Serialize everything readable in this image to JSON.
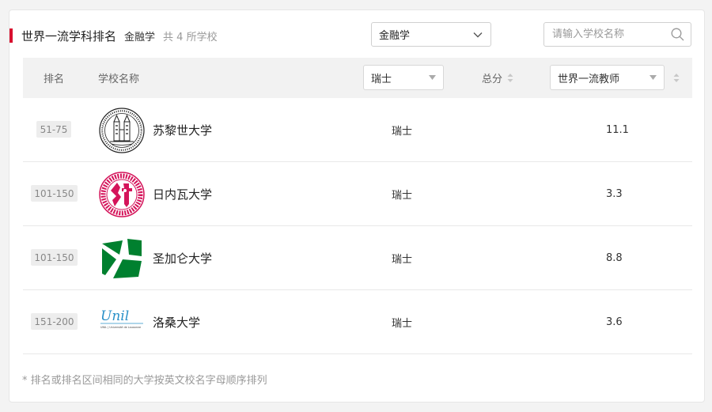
{
  "header": {
    "title": "世界一流学科排名",
    "subject": "金融学",
    "count_text": "共 4 所学校"
  },
  "subject_select": {
    "value": "金融学"
  },
  "search": {
    "placeholder": "请输入学校名称",
    "value": ""
  },
  "table": {
    "col_rank": "排名",
    "col_school": "学校名称",
    "col_country_filter": "瑞士",
    "col_total": "总分",
    "col_indicator": "世界一流教师"
  },
  "rows": [
    {
      "rank": "51-75",
      "school": "苏黎世大学",
      "country": "瑞士",
      "score": "11.1",
      "logo": "university-of-zurich-seal-icon"
    },
    {
      "rank": "101-150",
      "school": "日内瓦大学",
      "country": "瑞士",
      "score": "3.3",
      "logo": "university-of-geneva-seal-icon"
    },
    {
      "rank": "101-150",
      "school": "圣加仑大学",
      "country": "瑞士",
      "score": "8.8",
      "logo": "university-of-st-gallen-logo-icon"
    },
    {
      "rank": "151-200",
      "school": "洛桑大学",
      "country": "瑞士",
      "score": "3.6",
      "logo": "university-of-lausanne-logo-icon"
    }
  ],
  "unil_logo": {
    "wordmark": "Unil",
    "caption": "UNIL | Université de Lausanne"
  },
  "footnote": "* 排名或排名区间相同的大学按英文校名字母顺序排列",
  "colors": {
    "accent": "#d8102f",
    "geneva": "#d4145a",
    "stgallen": "#00802f",
    "lausanne": "#2a90c8"
  }
}
